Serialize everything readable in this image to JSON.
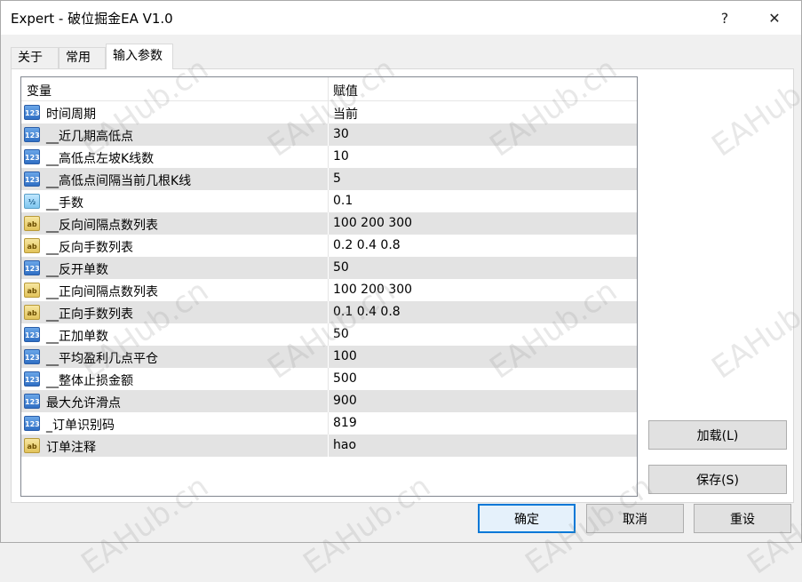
{
  "window": {
    "title": "Expert - 破位掘金EA V1.0",
    "help_glyph": "?",
    "close_glyph": "✕"
  },
  "tabs": [
    {
      "label": "关于",
      "active": false
    },
    {
      "label": "常用",
      "active": false
    },
    {
      "label": "输入参数",
      "active": true
    }
  ],
  "grid": {
    "col_variable": "变量",
    "col_value": "赋值",
    "rows": [
      {
        "type": "int",
        "icon_text": "123",
        "name": "时间周期",
        "value": "当前"
      },
      {
        "type": "int",
        "icon_text": "123",
        "name": "__近几期高低点",
        "value": "30"
      },
      {
        "type": "int",
        "icon_text": "123",
        "name": "__高低点左坡K线数",
        "value": "10"
      },
      {
        "type": "int",
        "icon_text": "123",
        "name": "__高低点间隔当前几根K线",
        "value": "5"
      },
      {
        "type": "dbl",
        "icon_text": "½",
        "name": "__手数",
        "value": "0.1"
      },
      {
        "type": "str",
        "icon_text": "ab",
        "name": "__反向间隔点数列表",
        "value": "100 200 300"
      },
      {
        "type": "str",
        "icon_text": "ab",
        "name": "__反向手数列表",
        "value": "0.2 0.4 0.8"
      },
      {
        "type": "int",
        "icon_text": "123",
        "name": "__反开单数",
        "value": "50"
      },
      {
        "type": "str",
        "icon_text": "ab",
        "name": "__正向间隔点数列表",
        "value": "100 200 300"
      },
      {
        "type": "str",
        "icon_text": "ab",
        "name": "__正向手数列表",
        "value": "0.1 0.4 0.8"
      },
      {
        "type": "int",
        "icon_text": "123",
        "name": "__正加单数",
        "value": "50"
      },
      {
        "type": "int",
        "icon_text": "123",
        "name": "__平均盈利几点平仓",
        "value": "100"
      },
      {
        "type": "int",
        "icon_text": "123",
        "name": "__整体止损金额",
        "value": "500"
      },
      {
        "type": "int",
        "icon_text": "123",
        "name": "最大允许滑点",
        "value": "900"
      },
      {
        "type": "int",
        "icon_text": "123",
        "name": "_订单识别码",
        "value": "819"
      },
      {
        "type": "str",
        "icon_text": "ab",
        "name": "订单注释",
        "value": "hao"
      }
    ]
  },
  "buttons": {
    "load": "加载(L)",
    "save": "保存(S)",
    "ok": "确定",
    "cancel": "取消",
    "reset": "重设"
  },
  "watermark": "EAHub.cn",
  "colors": {
    "accent": "#0078d7",
    "row_shade": "#e3e3e3"
  }
}
